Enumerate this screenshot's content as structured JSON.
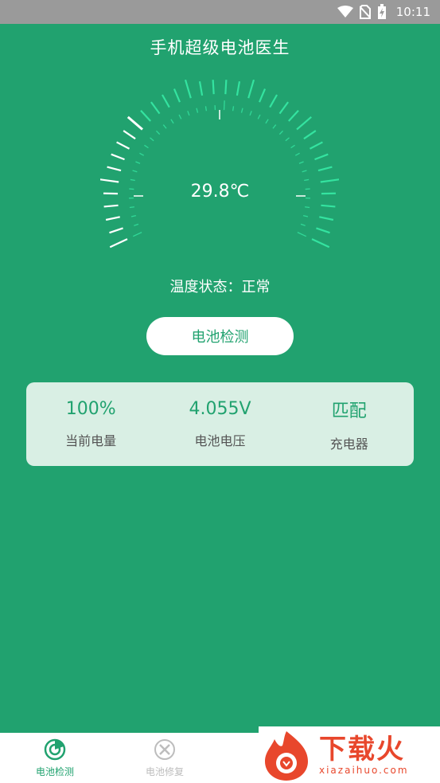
{
  "status_bar": {
    "time": "10:11",
    "icons": [
      "wifi-icon",
      "no-sim-icon",
      "battery-charging-icon"
    ]
  },
  "app_title": "手机超级电池医生",
  "gauge": {
    "temperature": "29.8℃",
    "level": 0.3,
    "active_color": "#ffffff",
    "inactive_color": "#34e3a0"
  },
  "status": {
    "text": "温度状态：正常"
  },
  "detect_button": {
    "label": "电池检测"
  },
  "info": [
    {
      "value": "100%",
      "label": "当前电量"
    },
    {
      "value": "4.055V",
      "label": "电池电压"
    },
    {
      "value": "匹配",
      "label": "充电器"
    }
  ],
  "nav": [
    {
      "label": "电池检测",
      "icon": "radar-icon",
      "active": true
    },
    {
      "label": "电池修复",
      "icon": "repair-tools-icon",
      "active": false
    },
    {
      "label": "",
      "icon": "more-icon",
      "active": false
    }
  ],
  "watermark": {
    "big": "下载火",
    "small": "xiazaihuo.com",
    "icon": "flame-logo-icon"
  },
  "colors": {
    "primary": "#21a26f",
    "card": "#d9efe4",
    "gauge_light": "#34e3a0"
  }
}
